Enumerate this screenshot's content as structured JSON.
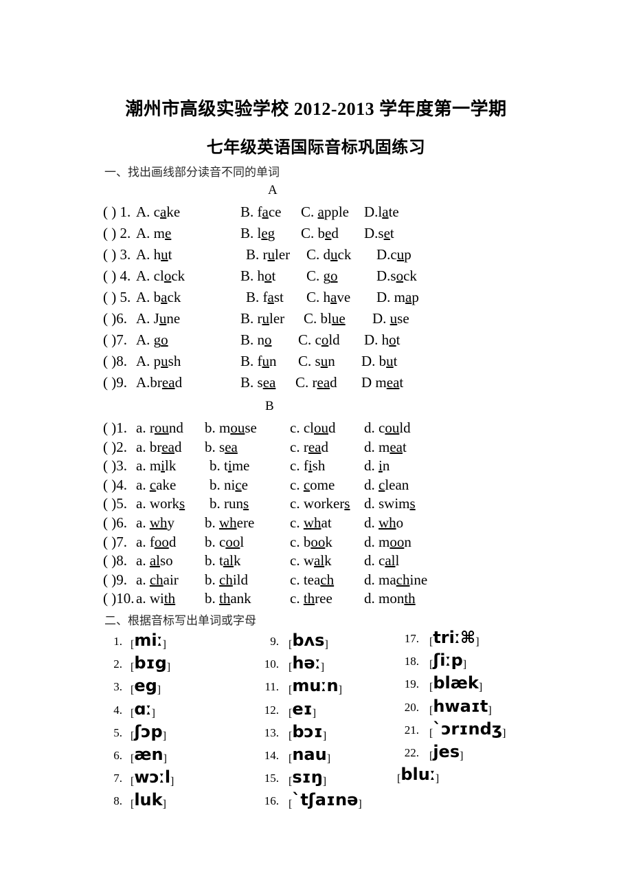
{
  "document": {
    "title_line1": "潮州市高级实验学校 2012-2013 学年度第一学期",
    "title_line2": "七年级英语国际音标巩固练习"
  },
  "section_one": {
    "heading": "一、找出画线部分读音不同的单词",
    "group_a_label": "A",
    "group_b_label": "B",
    "group_a": [
      {
        "marker": "(    ) 1.",
        "options": [
          "A. c_a_ke",
          "B. f_a_ce",
          "C. _a_pple",
          "D.l_a_te"
        ]
      },
      {
        "marker": "(    ) 2.",
        "options": [
          "A. m_e_",
          "B. l_e_g",
          "C. b_e_d",
          "D.s_e_t"
        ]
      },
      {
        "marker": "(    ) 3.",
        "options": [
          "A. h_u_t",
          "B. r_u_ler",
          "C. d_u_ck",
          "D.c_u_p"
        ]
      },
      {
        "marker": "(    ) 4.",
        "options": [
          "A. cl_o_ck",
          "B. h_o_t",
          "C. g_o_",
          "D.s_o_ck"
        ]
      },
      {
        "marker": "(    ) 5.",
        "options": [
          "A. b_a_ck",
          "B. f_a_st",
          "C. h_a_ve",
          "D. m_a_p"
        ]
      },
      {
        "marker": "(    )6.",
        "options": [
          "A. J_u_ne",
          "B. r_u_ler",
          "C. bl_ue_",
          "D. _u_se"
        ]
      },
      {
        "marker": "(    )7.",
        "options": [
          "A. g_o_",
          "B. n_o_",
          "C. c_o_ld",
          "D. h_o_t"
        ]
      },
      {
        "marker": "(    )8.",
        "options": [
          "A. p_u_sh",
          "B. f_u_n",
          "C. s_u_n",
          "D. b_u_t"
        ]
      },
      {
        "marker": "(    )9.",
        "options": [
          "A.br_ea_d",
          "B. s_ea_",
          "C. r_ea_d",
          "D m_ea_t"
        ]
      }
    ],
    "group_b": [
      {
        "marker": "(    )1.",
        "options": [
          "a. r_ou_nd",
          "b. m_ou_se",
          "c. cl_ou_d",
          "d. c_ou_ld"
        ]
      },
      {
        "marker": "(    )2.",
        "options": [
          "a. br_ea_d",
          "b. s_ea_",
          "c. r_ea_d",
          "d. m_ea_t"
        ]
      },
      {
        "marker": "(    )3.",
        "options": [
          "a. m_i_lk",
          "b. t_i_me",
          "c. f_i_sh",
          "d. _i_n"
        ]
      },
      {
        "marker": "(    )4.",
        "options": [
          "a. _c_ake",
          "b. ni_c_e",
          "c. _c_ome",
          "d. _c_lean"
        ]
      },
      {
        "marker": "(    )5.",
        "options": [
          "a. work_s_",
          "b. run_s_",
          "c. worker_s_",
          "d. swim_s_"
        ]
      },
      {
        "marker": "(    )6.",
        "options": [
          "a. _wh_y",
          "b. _wh_ere",
          "c. _wh_at",
          "d. _wh_o"
        ]
      },
      {
        "marker": "(    )7.",
        "options": [
          "a. f_oo_d",
          "b. c_oo_l",
          "c. b_oo_k",
          "d. m_oo_n"
        ]
      },
      {
        "marker": "(    )8.",
        "options": [
          "a. _al_so",
          "b. t_al_k",
          "c. w_al_k",
          "d. c_al_l"
        ]
      },
      {
        "marker": "(    )9.",
        "options": [
          "a. _ch_air",
          "b. _ch_ild",
          "c. tea_ch_",
          "d. ma_ch_ine"
        ]
      },
      {
        "marker": "(    )10.",
        "options": [
          "a. wi_th_",
          "b. _th_ank",
          "c. _th_ree",
          "d. mon_th_"
        ]
      }
    ]
  },
  "section_two": {
    "heading": "二、根据音标写出单词或字母",
    "column1": [
      {
        "num": "1.",
        "phonetic": "miː"
      },
      {
        "num": "2.",
        "phonetic": "bɪg"
      },
      {
        "num": "3.",
        "phonetic": "eg"
      },
      {
        "num": "4.",
        "phonetic": "ɑː"
      },
      {
        "num": "5.",
        "phonetic": "ʃɔp"
      },
      {
        "num": "6.",
        "phonetic": "æn"
      },
      {
        "num": "7.",
        "phonetic": "wɔːl"
      },
      {
        "num": "8.",
        "phonetic": "luk"
      }
    ],
    "column2": [
      {
        "num": "9.",
        "phonetic": "bʌs"
      },
      {
        "num": "10.",
        "phonetic": "həː"
      },
      {
        "num": "11.",
        "phonetic": "muːn"
      },
      {
        "num": "12.",
        "phonetic": "eɪ"
      },
      {
        "num": "13.",
        "phonetic": "bɔɪ"
      },
      {
        "num": "14.",
        "phonetic": "nau"
      },
      {
        "num": "15.",
        "phonetic": "sɪŋ"
      },
      {
        "num": "16.",
        "phonetic": "ˋtʃaɪnə"
      }
    ],
    "column3": [
      {
        "num": "17.",
        "phonetic": "triː⌘"
      },
      {
        "num": "18.",
        "phonetic": "ʃiːp"
      },
      {
        "num": "19.",
        "phonetic": "blæk"
      },
      {
        "num": "20.",
        "phonetic": "hwaɪt"
      },
      {
        "num": "21.",
        "phonetic": "ˋɔrɪndʒ"
      },
      {
        "num": "22.",
        "phonetic": "jes"
      },
      {
        "num": "",
        "phonetic": "bluː"
      }
    ]
  }
}
